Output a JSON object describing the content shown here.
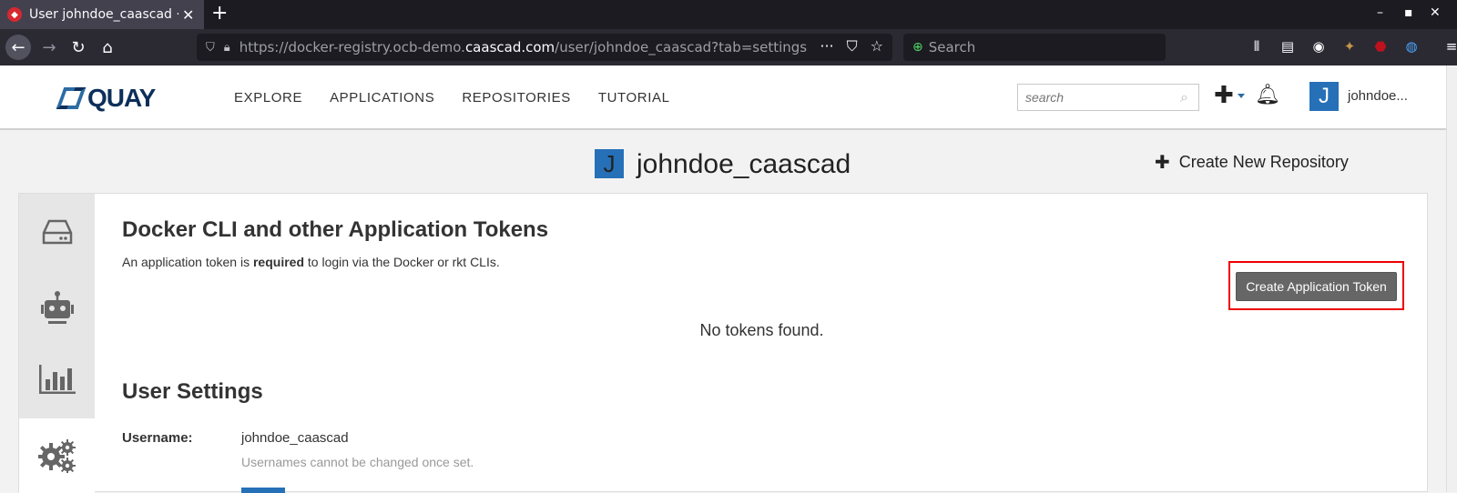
{
  "browser": {
    "tab_title": "User johndoe_caascad · Quay",
    "tab_favicon": "quay-favicon",
    "url_prefix": "https://docker-registry.ocb-demo.",
    "url_domain": "caascad.com",
    "url_suffix": "/user/johndoe_caascad?tab=settings",
    "search_placeholder": "Search"
  },
  "header": {
    "logo_text": "QUAY",
    "nav": [
      "EXPLORE",
      "APPLICATIONS",
      "REPOSITORIES",
      "TUTORIAL"
    ],
    "search_placeholder": "search",
    "user_initial": "J",
    "user_short": "johndoe..."
  },
  "page": {
    "avatar_initial": "J",
    "username_heading": "johndoe_caascad",
    "create_repo_label": "Create New Repository"
  },
  "tokens": {
    "title": "Docker CLI and other Application Tokens",
    "desc_before": "An application token is ",
    "desc_bold": "required",
    "desc_after": " to login via the Docker or rkt CLIs.",
    "create_button": "Create Application Token",
    "empty_text": "No tokens found."
  },
  "settings": {
    "title": "User Settings",
    "username_label": "Username:",
    "username_value": "johndoe_caascad",
    "username_help": "Usernames cannot be changed once set."
  },
  "sidebar": {
    "items": [
      {
        "icon": "hard-drive-icon",
        "active": false
      },
      {
        "icon": "robot-icon",
        "active": false
      },
      {
        "icon": "bar-chart-icon",
        "active": false
      },
      {
        "icon": "gears-icon",
        "active": true
      }
    ]
  },
  "colors": {
    "accent": "#2670b8",
    "highlight_border": "#ee0000",
    "button_gray": "#666666"
  }
}
